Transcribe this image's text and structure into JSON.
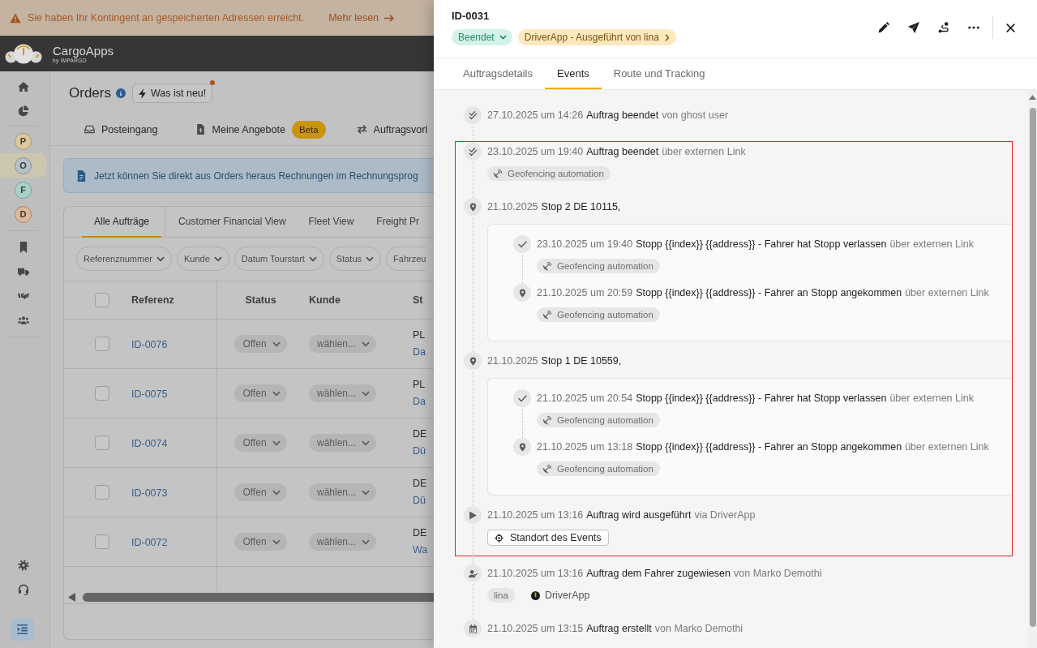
{
  "banner": {
    "message": "Sie haben Ihr Kontingent an gespeicherten Adressen erreicht.",
    "link": "Mehr lesen"
  },
  "app_header": {
    "brand": "CargoApps",
    "byline": "by IMPARGO"
  },
  "sidebar": {
    "workspaces": [
      {
        "letter": "P",
        "color": "#dcc89e",
        "selected": false
      },
      {
        "letter": "O",
        "color": "#b7c1ca",
        "selected": true
      },
      {
        "letter": "F",
        "color": "#a9d2cb",
        "selected": false
      },
      {
        "letter": "D",
        "color": "#dbb79b",
        "selected": false
      }
    ]
  },
  "page": {
    "title": "Orders",
    "whats_new": "Was ist neu!",
    "nav": [
      {
        "kind": "inbox",
        "label": "Posteingang"
      },
      {
        "kind": "offers",
        "label": "Meine Angebote",
        "badge": "Beta"
      },
      {
        "kind": "templates",
        "label": "Auftragsvorl"
      }
    ],
    "notice": "Jetzt können Sie direkt aus Orders heraus Rechnungen im Rechnungsprog"
  },
  "orders": {
    "views": [
      {
        "label": "Alle Aufträge",
        "selected": true
      },
      {
        "label": "Customer Financial View",
        "selected": false
      },
      {
        "label": "Fleet View",
        "selected": false
      },
      {
        "label": "Freight Pr",
        "selected": false
      }
    ],
    "filters": [
      {
        "label": "Referenznummer",
        "caret": true
      },
      {
        "label": "Kunde",
        "caret": true
      },
      {
        "label": "Datum Tourstart",
        "caret": true
      },
      {
        "label": "Status",
        "caret": true
      },
      {
        "label": "Fahrzeu",
        "caret": false
      }
    ],
    "select_all_checked": false,
    "columns": [
      "Referenz",
      "Status",
      "Kunde",
      "St"
    ],
    "rows": [
      {
        "checked": false,
        "reference": "ID-0076",
        "status": "Offen",
        "customer": "wählen...",
        "column_4": [
          "PL",
          "Da"
        ]
      },
      {
        "checked": false,
        "reference": "ID-0075",
        "status": "Offen",
        "customer": "wählen...",
        "column_4": [
          "PL",
          "Da"
        ]
      },
      {
        "checked": false,
        "reference": "ID-0074",
        "status": "Offen",
        "customer": "wählen...",
        "column_4": [
          "DE",
          "Dü"
        ]
      },
      {
        "checked": false,
        "reference": "ID-0073",
        "status": "Offen",
        "customer": "wählen...",
        "column_4": [
          "DE",
          "Dü"
        ]
      },
      {
        "checked": false,
        "reference": "ID-0072",
        "status": "Offen",
        "customer": "wählen...",
        "column_4": [
          "DE",
          "Wa"
        ]
      }
    ]
  },
  "order_panel": {
    "id": "ID-0031",
    "status": "Beendet",
    "execution": "DriverApp - Ausgeführt von lina",
    "tabs": [
      {
        "label": "Auftragsdetails",
        "selected": false
      },
      {
        "label": "Events",
        "selected": true
      },
      {
        "label": "Route und Tracking",
        "selected": false
      }
    ],
    "sections": [
      {
        "highlighted": false,
        "events": [
          {
            "kind": "completed",
            "date": "27.10.2025 um 14:26",
            "title": "Auftrag beendet",
            "source": "von ghost user"
          }
        ]
      },
      {
        "highlighted": true,
        "events": [
          {
            "kind": "completed",
            "date": "23.10.2025 um 19:40",
            "title": "Auftrag beendet",
            "source": "über externen Link",
            "tags": [
              {
                "kind": "automation",
                "label": "Geofencing automation"
              }
            ]
          },
          {
            "kind": "stop",
            "date": "21.10.2025",
            "title": "Stop 2 DE 10115,",
            "children": [
              {
                "kind": "departed",
                "date": "23.10.2025 um 19:40",
                "title": "Stopp {{index}} {{address}} - Fahrer hat Stopp verlassen",
                "source": "über externen Link",
                "tags": [
                  {
                    "kind": "automation",
                    "label": "Geofencing automation"
                  }
                ]
              },
              {
                "kind": "arrived",
                "date": "21.10.2025 um 20:59",
                "title": "Stopp {{index}} {{address}} - Fahrer an Stopp angekommen",
                "source": "über externen Link",
                "tags": [
                  {
                    "kind": "automation",
                    "label": "Geofencing automation"
                  }
                ]
              }
            ]
          },
          {
            "kind": "stop",
            "date": "21.10.2025",
            "title": "Stop 1 DE 10559,",
            "children": [
              {
                "kind": "departed",
                "date": "21.10.2025 um 20:54",
                "title": "Stopp {{index}} {{address}} - Fahrer hat Stopp verlassen",
                "source": "über externen Link",
                "tags": [
                  {
                    "kind": "automation",
                    "label": "Geofencing automation"
                  }
                ]
              },
              {
                "kind": "arrived",
                "date": "21.10.2025 um 13:18",
                "title": "Stopp {{index}} {{address}} - Fahrer an Stopp angekommen",
                "source": "über externen Link",
                "tags": [
                  {
                    "kind": "automation",
                    "label": "Geofencing automation"
                  }
                ]
              }
            ]
          },
          {
            "kind": "started",
            "date": "21.10.2025 um 13:16",
            "title": "Auftrag wird ausgeführt",
            "source": "via DriverApp",
            "tags": [
              {
                "kind": "location_button",
                "label": "Standort des Events"
              }
            ]
          }
        ]
      },
      {
        "highlighted": false,
        "events": [
          {
            "kind": "assigned",
            "date": "21.10.2025 um 13:16",
            "title": "Auftrag dem Fahrer zugewiesen",
            "source": "von Marko Demothi",
            "tags": [
              {
                "kind": "user",
                "label": "lina"
              },
              {
                "kind": "app",
                "label": "DriverApp"
              }
            ]
          },
          {
            "kind": "created",
            "date": "21.10.2025 um 13:15",
            "title": "Auftrag erstellt",
            "source": "von Marko Demothi"
          }
        ]
      }
    ]
  }
}
